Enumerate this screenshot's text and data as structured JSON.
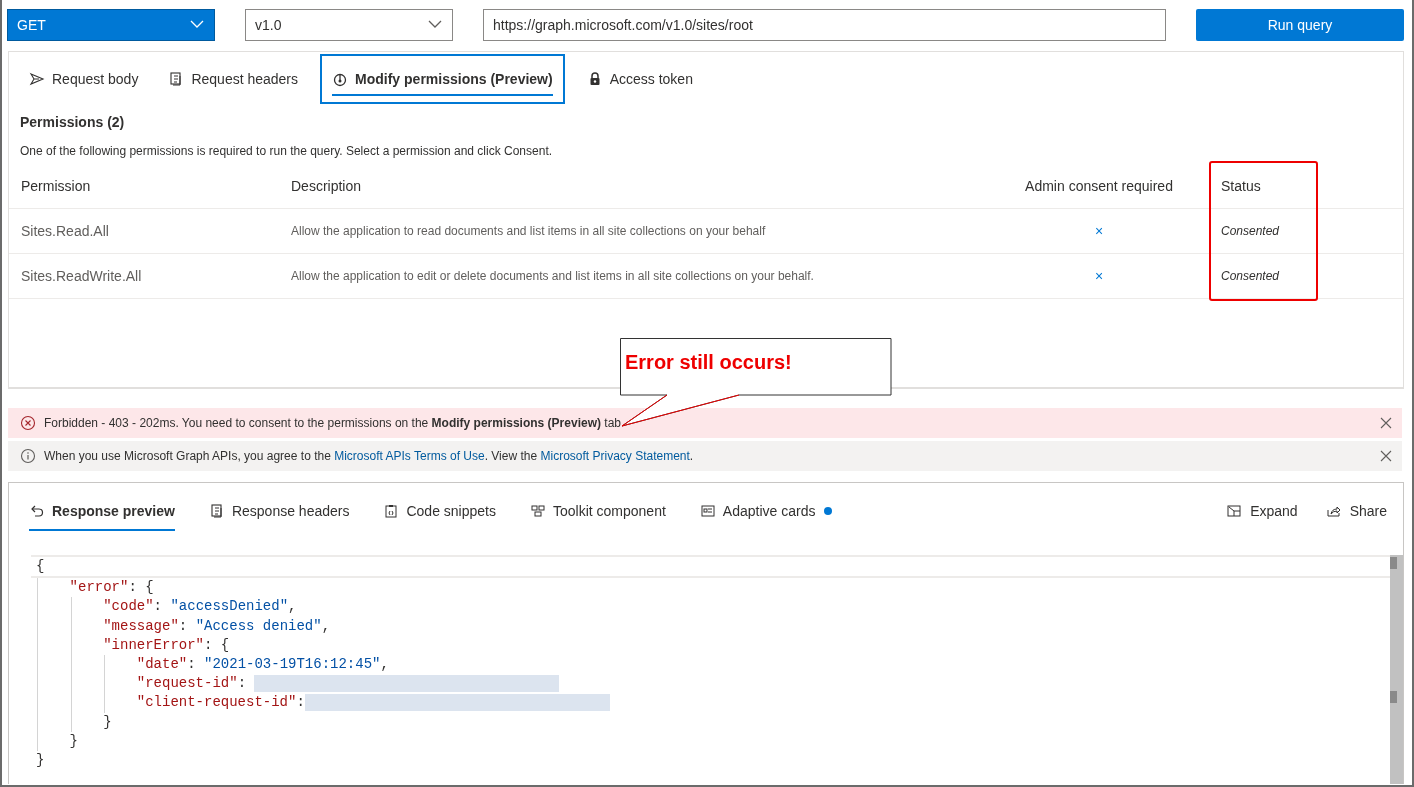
{
  "query_bar": {
    "method": "GET",
    "version": "v1.0",
    "url": "https://graph.microsoft.com/v1.0/sites/root",
    "run_button": "Run query"
  },
  "request_tabs": [
    {
      "label": "Request body",
      "selected": false
    },
    {
      "label": "Request headers",
      "selected": false
    },
    {
      "label": "Modify permissions (Preview)",
      "selected": true
    },
    {
      "label": "Access token",
      "selected": false
    }
  ],
  "permissions": {
    "title": "Permissions (2)",
    "instructions": "One of the following permissions is required to run the query. Select a permission and click Consent.",
    "columns": [
      "Permission",
      "Description",
      "Admin consent required",
      "Status"
    ],
    "rows": [
      {
        "permission": "Sites.Read.All",
        "description": "Allow the application to read documents and list items in all site collections on your behalf",
        "admin_consent": "×",
        "status": "Consented"
      },
      {
        "permission": "Sites.ReadWrite.All",
        "description": "Allow the application to edit or delete documents and list items in all site collections on your behalf.",
        "admin_consent": "×",
        "status": "Consented"
      }
    ]
  },
  "callout": {
    "text": "Error still occurs!"
  },
  "messages": [
    {
      "kind": "error",
      "parts": [
        {
          "kind": "plain",
          "text": "Forbidden - 403 - 202ms. You need to consent to the permissions on the **Modify permissions (Preview)** tab"
        }
      ]
    },
    {
      "kind": "info",
      "parts": [
        {
          "kind": "plain",
          "text": "When you use Microsoft Graph APIs, you agree to the "
        },
        {
          "kind": "link",
          "text": "Microsoft APIs Terms of Use"
        },
        {
          "kind": "plain",
          "text": ". View the "
        },
        {
          "kind": "link",
          "text": "Microsoft Privacy Statement"
        },
        {
          "kind": "plain",
          "text": "."
        }
      ]
    }
  ],
  "response_tabs": [
    {
      "label": "Response preview",
      "selected": true,
      "dot": false
    },
    {
      "label": "Response headers",
      "selected": false,
      "dot": false
    },
    {
      "label": "Code snippets",
      "selected": false,
      "dot": false
    },
    {
      "label": "Toolkit component",
      "selected": false,
      "dot": false
    },
    {
      "label": "Adaptive cards",
      "selected": false,
      "dot": true
    }
  ],
  "response_actions": [
    "Expand",
    "Share"
  ],
  "response_body": {
    "text": "{",
    "highlighted": true,
    "close": "}",
    "children": [
      {
        "key": "\"error\"",
        "sep": ": ",
        "text": "{",
        "close": "}",
        "children": [
          {
            "key": "\"code\"",
            "sep": ": ",
            "value": "\"accessDenied\"",
            "end": ","
          },
          {
            "key": "\"message\"",
            "sep": ": ",
            "value": "\"Access denied\"",
            "end": ","
          },
          {
            "key": "\"innerError\"",
            "sep": ": ",
            "text": "{",
            "close": "}",
            "children": [
              {
                "key": "\"date\"",
                "sep": ": ",
                "value": "\"2021-03-19T16:12:45\"",
                "end": ","
              },
              {
                "key": "\"request-id\"",
                "sep": ": ",
                "redacted": true
              },
              {
                "key": "\"client-request-id\"",
                "sep": ":",
                "redacted": true
              }
            ]
          }
        ]
      }
    ]
  }
}
